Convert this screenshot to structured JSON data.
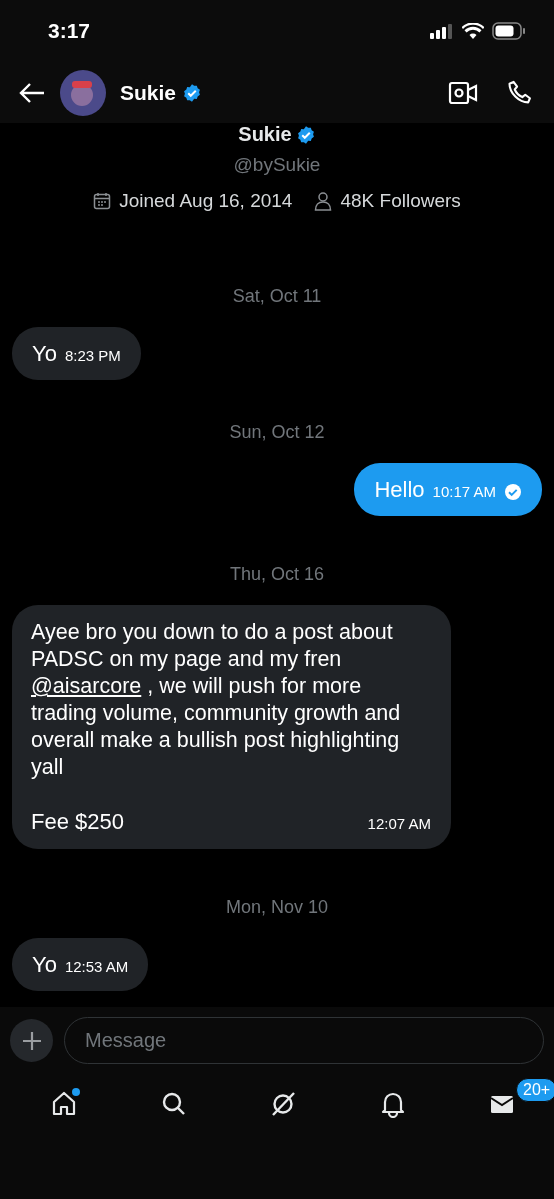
{
  "status_bar": {
    "time": "3:17"
  },
  "header": {
    "name": "Sukie",
    "verified": true
  },
  "profile": {
    "name": "Sukie",
    "verified": true,
    "handle": "@bySukie",
    "joined": "Joined Aug 16, 2014",
    "followers": "48K Followers"
  },
  "messages": [
    {
      "kind": "date",
      "text": "Sat, Oct 11"
    },
    {
      "kind": "incoming",
      "text": "Yo",
      "time": "8:23 PM"
    },
    {
      "kind": "date",
      "text": "Sun, Oct 12"
    },
    {
      "kind": "outgoing",
      "text": "Hello",
      "time": "10:17 AM",
      "seen": true
    },
    {
      "kind": "date",
      "text": "Thu, Oct 16"
    },
    {
      "kind": "long",
      "before": "Ayee bro you down to do a post about PADSC on my page and my fren",
      "link": "@aisarcore",
      "after": ", we will push for more trading volume, community growth and overall make a bullish post highlighting yall",
      "last_line": "Fee $250",
      "time": "12:07 AM"
    },
    {
      "kind": "date",
      "text": "Mon, Nov 10"
    },
    {
      "kind": "incoming",
      "text": "Yo",
      "time": "12:53 AM"
    }
  ],
  "composer": {
    "placeholder": "Message"
  },
  "tab_bar": [
    {
      "kind": "home",
      "selected": false,
      "new_dot": true
    },
    {
      "kind": "search",
      "selected": false
    },
    {
      "kind": "explore",
      "selected": false
    },
    {
      "kind": "notifications",
      "selected": false
    },
    {
      "kind": "messages",
      "selected": false,
      "badge": "20+"
    }
  ]
}
